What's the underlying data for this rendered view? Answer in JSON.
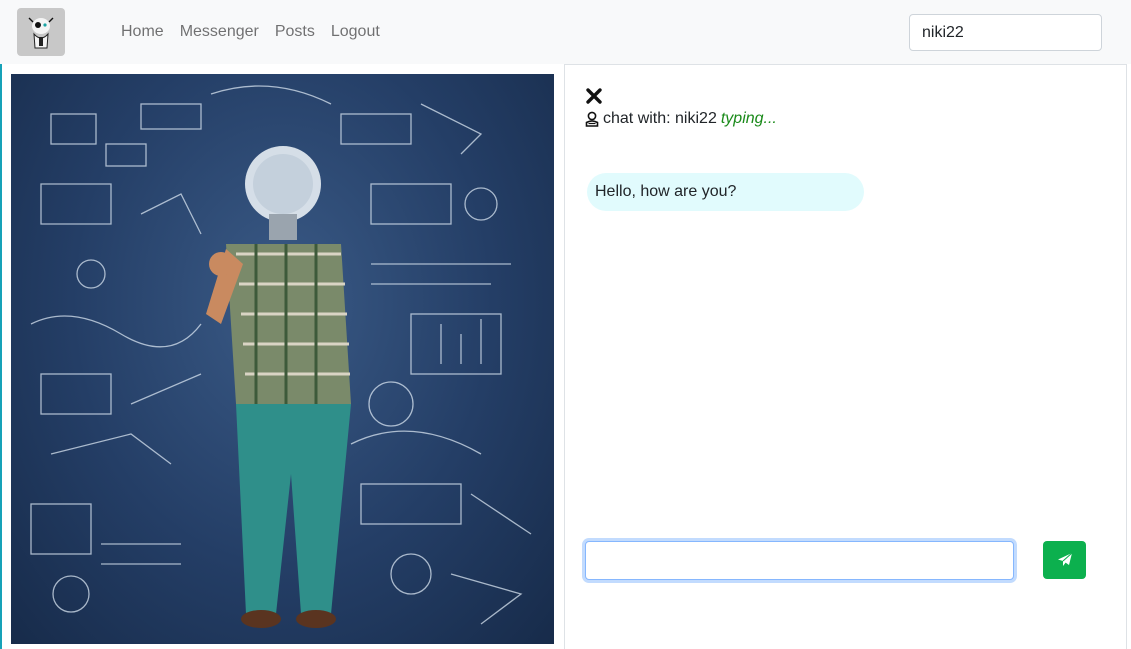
{
  "navbar": {
    "brand_icon": "robot-icon",
    "links": [
      {
        "label": "Home"
      },
      {
        "label": "Messenger"
      },
      {
        "label": "Posts"
      },
      {
        "label": "Logout"
      }
    ],
    "search_value": "niki22"
  },
  "hero": {
    "description_icon": "lightbulb-head-man-image"
  },
  "chat": {
    "close_icon": "close-icon",
    "header_icon": "user-icon",
    "header_prefix": "chat with: niki22",
    "typing_status": "typing...",
    "messages": [
      {
        "text": "Hello, how are you?"
      }
    ],
    "input_value": "",
    "send_icon": "paper-plane-icon"
  },
  "colors": {
    "navbar_bg": "#f8f9fa",
    "send_button": "#0cb04e",
    "bubble_bg": "#e1fbfd",
    "typing_text": "#1a8a1a",
    "hero_bg": "#243e66"
  }
}
